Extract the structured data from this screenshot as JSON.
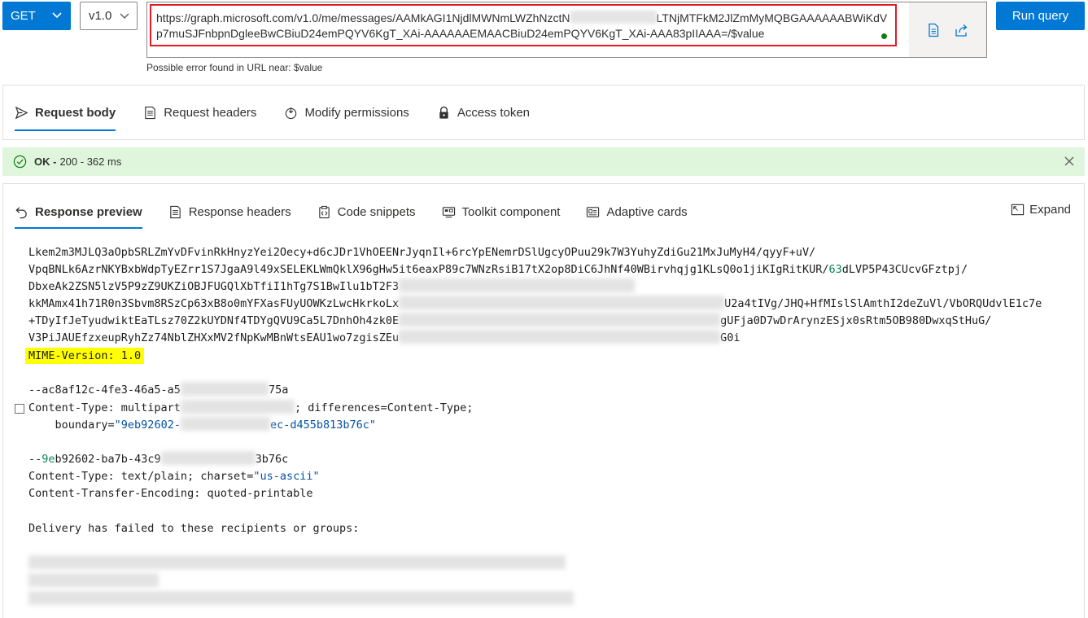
{
  "toolbar": {
    "method": "GET",
    "version": "v1.0",
    "url_part1": "https://graph.microsoft.com/v1.0/me/messages/AAMkAGI1NjdlMWNmLWZhNzctN",
    "url_part2": "LTNjMTFkM2JlZmMyMQBGAAAAAABWiKdVp7muSJFnbpnDgleeBwCBiuD24emPQYV6KgT_XAi-AAAAAAEMAACBiuD24emPQYV6KgT_XAi-AAA83pIIAAA=/$value",
    "run_label": "Run query",
    "url_error": "Possible error found in URL near: $value"
  },
  "request_tabs": [
    {
      "label": "Request body",
      "icon": "send-icon"
    },
    {
      "label": "Request headers",
      "icon": "headers-icon"
    },
    {
      "label": "Modify permissions",
      "icon": "permissions-icon"
    },
    {
      "label": "Access token",
      "icon": "lock-icon"
    }
  ],
  "status": {
    "ok": "OK -",
    "detail": "200 - 362 ms",
    "color": "#dff6dd"
  },
  "response_tabs": [
    {
      "label": "Response preview",
      "icon": "undo-arrow-icon"
    },
    {
      "label": "Response headers",
      "icon": "document-icon"
    },
    {
      "label": "Code snippets",
      "icon": "clipboard-code-icon"
    },
    {
      "label": "Toolkit component",
      "icon": "toolkit-icon"
    },
    {
      "label": "Adaptive cards",
      "icon": "card-icon"
    }
  ],
  "expand_label": "Expand",
  "code": {
    "l1": "Lkem2m3MJLQ3aOpbSRLZmYvDFvinRkHnyzYei2Oecy+d6cJDr1VhOEENrJyqnIl+6rcYpENemrDSlUgcyOPuu29k7W3YuhyZdiGu21MxJuMyH4/qyyF+uV/",
    "l2a": "VpqBNLk6AzrNKYBxbWdpTyEZrr1S7JgaA9l49xSELEKLWmQklX96gHw5it6eaxP89c7WNzRsiB17tX2op8DiC6JhNf40WBirvhqjg1KLsQ0o1jiKIgRitKUR/",
    "l2b": "63",
    "l2c": "dLVP5P43CUcvGFztpj/",
    "l3": "DbxeAk2ZSN5lzV5P9zZ9UKZiOBJFUGQlXbTfiI1hTg7S1BwIlu1bT2F3",
    "l4a": "kkMAmx41h71R0n3Sbvm8RSzCp63xB8o0mYFXasFUyUOWKzLwcHkrkoLx",
    "l4b": "U2a4tIVg/JHQ+HfMIslSlAmthI2deZuVl/VbORQUdvlE1c7e",
    "l5a": "+TDyIfJeTyudwiktEaTLsz70Z2kUYDNf4TDYgQVU9Ca5L7DnhOh4zk0E",
    "l5b": "gUFja0D7wDrArynzESjx0sRtm5OB980DwxqStHuG/",
    "l6a": "V3PiJAUEfzxeupRyhZz74NblZHXxMV2fNpKwMBnWtsEAU1wo7zgisZEu",
    "l6b": "G0i",
    "mime": "MIME-Version: 1.0",
    "boundary1a": "--ac8af12c-4fe3-46a5-a5",
    "boundary1b": "75a",
    "ct1a": "Content-Type: multipart",
    "ct1b": "; differences=Content-Type;",
    "bd_prefix": "    boundary=",
    "bd_val_a": "\"9eb92602-",
    "bd_val_b": "ec-d455b813b76c\"",
    "b2a": "--",
    "b2b": "9e",
    "b2c": "b92602-ba7b-43c9",
    "b2d": "3b76c",
    "ct2a": "Content-Type: text/plain; charset=",
    "ct2b": "\"us-ascii\"",
    "cte": "Content-Transfer-Encoding: quoted-printable",
    "delivery": "Delivery has failed to these recipients or groups:"
  }
}
